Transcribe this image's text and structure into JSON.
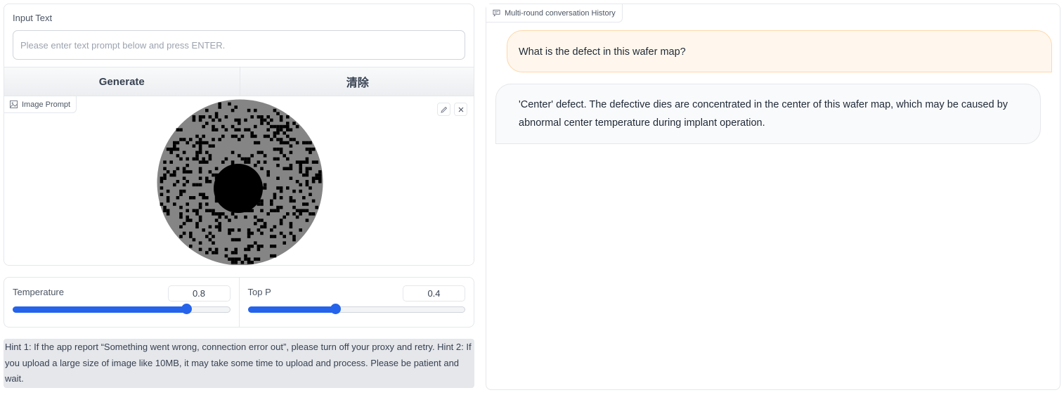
{
  "input": {
    "label": "Input Text",
    "placeholder": "Please enter text prompt below and press ENTER.",
    "value": ""
  },
  "buttons": {
    "generate": "Generate",
    "clear": "清除"
  },
  "image_prompt": {
    "label": "Image Prompt",
    "icon": "image-icon",
    "actions": [
      "edit-icon",
      "close-icon"
    ]
  },
  "sliders": {
    "temperature": {
      "label": "Temperature",
      "value": "0.8",
      "fraction": 0.8
    },
    "top_p": {
      "label": "Top P",
      "value": "0.4",
      "fraction": 0.4
    }
  },
  "hint": "Hint 1: If the app report “Something went wrong, connection error out”, please turn off your proxy and retry. Hint 2: If you upload a large size of image like 10MB, it may take some time to upload and process. Please be patient and wait.",
  "chat": {
    "label": "Multi-round conversation History",
    "icon": "chat-icon",
    "messages": [
      {
        "role": "user",
        "text": "What is the defect in this wafer map?"
      },
      {
        "role": "assistant",
        "text": "'Center' defect. The defective dies are concentrated in the center of this wafer map, which may be caused by abnormal center temperature during implant operation."
      }
    ]
  },
  "colors": {
    "accent": "#2563eb",
    "user_bubble": "#fff7ed",
    "user_bubble_border": "#fed7aa",
    "bot_bubble": "#f9fafb",
    "hint_bg": "#e5e7eb",
    "wafer_good": "#858585",
    "wafer_defect": "#000000"
  }
}
